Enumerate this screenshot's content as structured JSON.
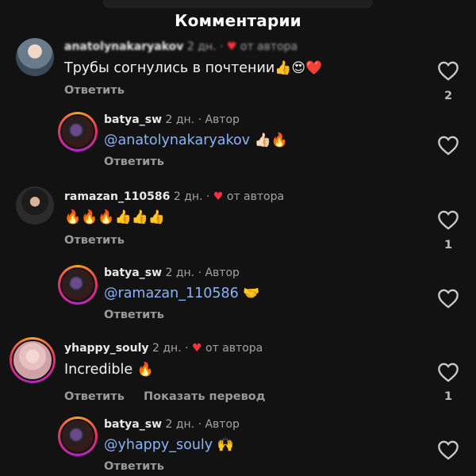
{
  "header": {
    "title": "Комментарии"
  },
  "comments": [
    {
      "username": "anatolynakaryakov",
      "time": "2 дн.",
      "separator": "·",
      "badge": "от автора",
      "text": "Трубы согнулись в почтении",
      "emoji": "👍😍❤️",
      "reply_label": "Ответить",
      "likes": "2"
    },
    {
      "username": "batya_sw",
      "time": "2 дн.",
      "separator": "·",
      "badge": "Автор",
      "mention": "@anatolynakaryakov",
      "emoji": "👍🏻🔥",
      "reply_label": "Ответить",
      "likes": ""
    },
    {
      "username": "ramazan_110586",
      "time": "2 дн.",
      "separator": "·",
      "badge": "от автора",
      "emoji": "🔥🔥🔥👍👍👍",
      "reply_label": "Ответить",
      "likes": "1"
    },
    {
      "username": "batya_sw",
      "time": "2 дн.",
      "separator": "·",
      "badge": "Автор",
      "mention": "@ramazan_110586",
      "emoji": "🤝",
      "reply_label": "Ответить",
      "likes": ""
    },
    {
      "username": "yhappy_souly",
      "time": "2 дн.",
      "separator": "·",
      "badge": "от автора",
      "text": "Incredible",
      "emoji": "🔥",
      "reply_label": "Ответить",
      "translate_label": "Показать перевод",
      "likes": "1"
    },
    {
      "username": "batya_sw",
      "time": "2 дн.",
      "separator": "·",
      "badge": "Автор",
      "mention": "@yhappy_souly",
      "emoji": "🙌",
      "reply_label": "Ответить",
      "likes": ""
    }
  ],
  "colors": {
    "background": "#121212",
    "mention": "#8ab4f8",
    "heart": "#ff3040",
    "secondary_text": "#9a9a9a"
  },
  "icons": {
    "like": "heart-outline-icon",
    "author_liked": "heart-filled-icon"
  }
}
